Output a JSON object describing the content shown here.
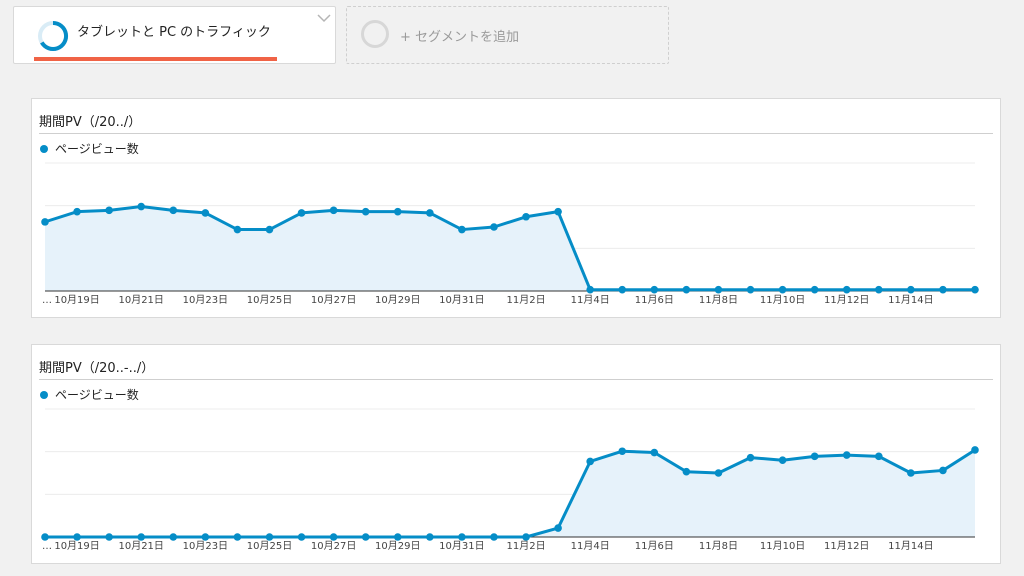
{
  "segment": {
    "label": "タブレットと PC のトラフィック",
    "color": "#f06346"
  },
  "add_segment": {
    "label": "+ セグメントを追加"
  },
  "colors": {
    "series": "#058dc7",
    "fill": "#e6f2fa"
  },
  "icons": {
    "segment_ring": "segment-ring-icon",
    "chevron": "chevron-down-icon",
    "add_ring": "add-segment-ring-icon",
    "legend": "legend-dot-icon"
  },
  "chart_data": [
    {
      "type": "area",
      "title": "期間PV（/20../）",
      "legend": "ページビュー数",
      "x_start_label": "…",
      "x_tick_labels": [
        "10月19日",
        "10月21日",
        "10月23日",
        "10月25日",
        "10月27日",
        "10月29日",
        "10月31日",
        "11月2日",
        "11月4日",
        "11月6日",
        "11月8日",
        "11月10日",
        "11月12日",
        "11月14日"
      ],
      "ylim": [
        0,
        100
      ],
      "grid": true,
      "series": [
        {
          "values": [
            54,
            62,
            63,
            66,
            63,
            61,
            48,
            48,
            61,
            63,
            62,
            62,
            61,
            48,
            50,
            58,
            62,
            1,
            1,
            1,
            1,
            1,
            1,
            1,
            1,
            1,
            1,
            1,
            1,
            1
          ]
        }
      ]
    },
    {
      "type": "area",
      "title": "期間PV（/20..-../）",
      "legend": "ページビュー数",
      "x_start_label": "…",
      "x_tick_labels": [
        "10月19日",
        "10月21日",
        "10月23日",
        "10月25日",
        "10月27日",
        "10月29日",
        "10月31日",
        "11月2日",
        "11月4日",
        "11月6日",
        "11月8日",
        "11月10日",
        "11月12日",
        "11月14日"
      ],
      "ylim": [
        0,
        100
      ],
      "grid": true,
      "series": [
        {
          "values": [
            0,
            0,
            0,
            0,
            0,
            0,
            0,
            0,
            0,
            0,
            0,
            0,
            0,
            0,
            0,
            0,
            7,
            59,
            67,
            66,
            51,
            50,
            62,
            60,
            63,
            64,
            63,
            50,
            52,
            68
          ]
        }
      ]
    }
  ]
}
